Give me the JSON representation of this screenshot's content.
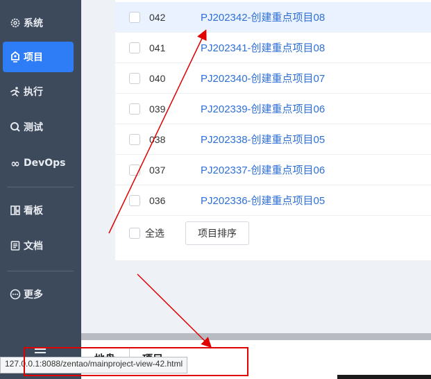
{
  "sidebar": {
    "items": [
      {
        "label": "系统",
        "icon": "gear-icon"
      },
      {
        "label": "项目",
        "icon": "project-icon",
        "active": true
      },
      {
        "label": "执行",
        "icon": "run-icon"
      },
      {
        "label": "测试",
        "icon": "test-icon"
      },
      {
        "label": "DevOps",
        "icon": "infinity-icon"
      },
      {
        "label": "看板",
        "icon": "kanban-icon"
      },
      {
        "label": "文档",
        "icon": "doc-icon"
      },
      {
        "label": "更多",
        "icon": "more-icon"
      }
    ]
  },
  "projects": [
    {
      "id": "042",
      "name": "PJ202342-创建重点项目08",
      "highlight": true
    },
    {
      "id": "041",
      "name": "PJ202341-创建重点项目08"
    },
    {
      "id": "040",
      "name": "PJ202340-创建重点项目07"
    },
    {
      "id": "039",
      "name": "PJ202339-创建重点项目06"
    },
    {
      "id": "038",
      "name": "PJ202338-创建重点项目05"
    },
    {
      "id": "037",
      "name": "PJ202337-创建重点项目06"
    },
    {
      "id": "036",
      "name": "PJ202336-创建重点项目05"
    }
  ],
  "footer": {
    "select_all": "全选",
    "sort_button": "项目排序"
  },
  "bottom_tabs": {
    "tab1": "地盘",
    "tab2": "项目"
  },
  "status_url": "127.0.0.1:8088/zentao/mainproject-view-42.html",
  "colors": {
    "sidebar": "#3d4a5c",
    "active": "#2e7cf6",
    "link": "#2e6fd8",
    "annotation": "#e00000"
  }
}
